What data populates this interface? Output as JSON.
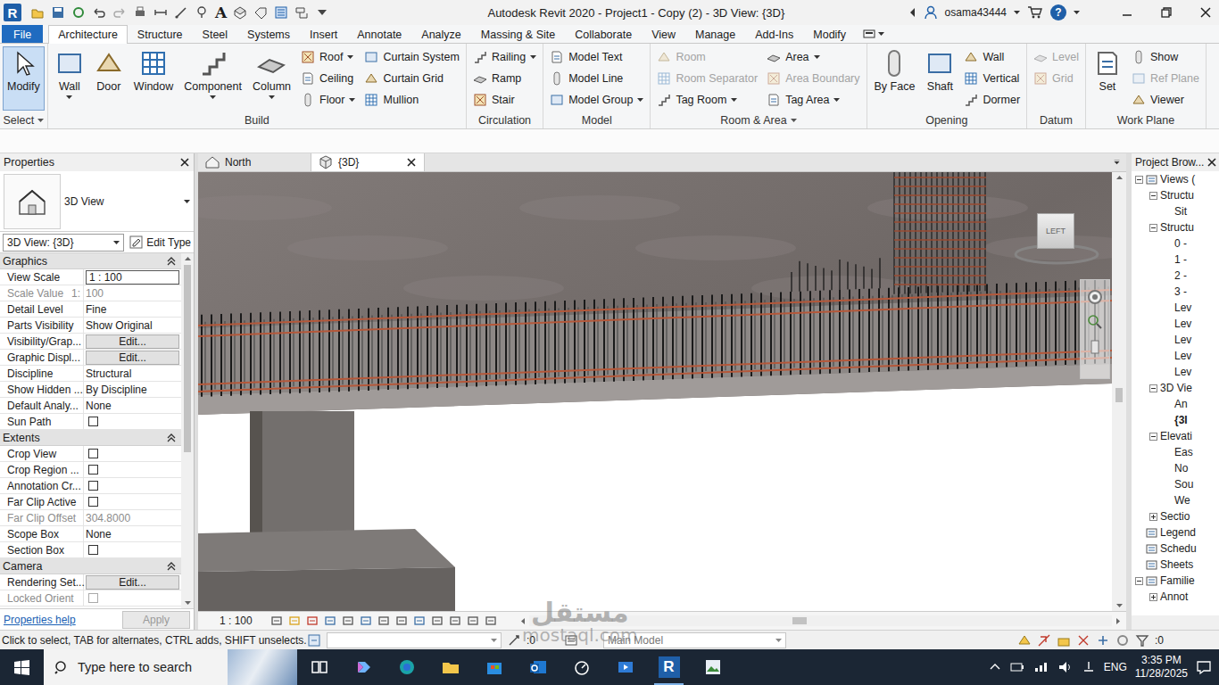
{
  "app_logo": "R",
  "window": {
    "title": "Autodesk Revit 2020 - Project1 - Copy (2) - 3D View: {3D}",
    "user": "osama43444",
    "help": "?"
  },
  "quick_access": {
    "text_tool": "A"
  },
  "ribbon_tabs": [
    {
      "label": "File",
      "selected": false,
      "kind": "file"
    },
    {
      "label": "Architecture",
      "selected": true,
      "kind": "tab"
    },
    {
      "label": "Structure",
      "selected": false,
      "kind": "tab"
    },
    {
      "label": "Steel",
      "selected": false,
      "kind": "tab"
    },
    {
      "label": "Systems",
      "selected": false,
      "kind": "tab"
    },
    {
      "label": "Insert",
      "selected": false,
      "kind": "tab"
    },
    {
      "label": "Annotate",
      "selected": false,
      "kind": "tab"
    },
    {
      "label": "Analyze",
      "selected": false,
      "kind": "tab"
    },
    {
      "label": "Massing & Site",
      "selected": false,
      "kind": "tab"
    },
    {
      "label": "Collaborate",
      "selected": false,
      "kind": "tab"
    },
    {
      "label": "View",
      "selected": false,
      "kind": "tab"
    },
    {
      "label": "Manage",
      "selected": false,
      "kind": "tab"
    },
    {
      "label": "Add-Ins",
      "selected": false,
      "kind": "tab"
    },
    {
      "label": "Modify",
      "selected": false,
      "kind": "tab"
    }
  ],
  "ribbon_groups": [
    {
      "title": "Select",
      "title_dropdown": true,
      "tools": [
        {
          "label": "Modify",
          "kind": "large",
          "selected": true,
          "disabled": false,
          "dropdown": false
        }
      ]
    },
    {
      "title": "Build",
      "title_dropdown": false,
      "tools": [
        {
          "label": "Wall",
          "kind": "large",
          "selected": false,
          "disabled": false,
          "dropdown": true
        },
        {
          "label": "Door",
          "kind": "large",
          "selected": false,
          "disabled": false,
          "dropdown": false
        },
        {
          "label": "Window",
          "kind": "large",
          "selected": false,
          "disabled": false,
          "dropdown": false
        },
        {
          "label": "Component",
          "kind": "large",
          "selected": false,
          "disabled": false,
          "dropdown": true
        },
        {
          "label": "Column",
          "kind": "large",
          "selected": false,
          "disabled": false,
          "dropdown": true
        },
        {
          "label": "Roof",
          "kind": "small",
          "selected": false,
          "disabled": false,
          "dropdown": true
        },
        {
          "label": "Ceiling",
          "kind": "small",
          "selected": false,
          "disabled": false,
          "dropdown": false
        },
        {
          "label": "Floor",
          "kind": "small",
          "selected": false,
          "disabled": false,
          "dropdown": true
        },
        {
          "label": "Curtain System",
          "kind": "small",
          "selected": false,
          "disabled": false,
          "dropdown": false
        },
        {
          "label": "Curtain Grid",
          "kind": "small",
          "selected": false,
          "disabled": false,
          "dropdown": false
        },
        {
          "label": "Mullion",
          "kind": "small",
          "selected": false,
          "disabled": false,
          "dropdown": false
        }
      ]
    },
    {
      "title": "Circulation",
      "title_dropdown": false,
      "tools": [
        {
          "label": "Railing",
          "kind": "small",
          "selected": false,
          "disabled": false,
          "dropdown": true
        },
        {
          "label": "Ramp",
          "kind": "small",
          "selected": false,
          "disabled": false,
          "dropdown": false
        },
        {
          "label": "Stair",
          "kind": "small",
          "selected": false,
          "disabled": false,
          "dropdown": false
        }
      ]
    },
    {
      "title": "Model",
      "title_dropdown": false,
      "tools": [
        {
          "label": "Model Text",
          "kind": "small",
          "selected": false,
          "disabled": false,
          "dropdown": false
        },
        {
          "label": "Model Line",
          "kind": "small",
          "selected": false,
          "disabled": false,
          "dropdown": false
        },
        {
          "label": "Model Group",
          "kind": "small",
          "selected": false,
          "disabled": false,
          "dropdown": true
        }
      ]
    },
    {
      "title": "Room & Area",
      "title_dropdown": true,
      "tools": [
        {
          "label": "Room",
          "kind": "small",
          "selected": false,
          "disabled": true,
          "dropdown": false
        },
        {
          "label": "Room Separator",
          "kind": "small",
          "selected": false,
          "disabled": true,
          "dropdown": false
        },
        {
          "label": "Tag Room",
          "kind": "small",
          "selected": false,
          "disabled": false,
          "dropdown": true
        },
        {
          "label": "Area",
          "kind": "small",
          "selected": false,
          "disabled": false,
          "dropdown": true
        },
        {
          "label": "Area Boundary",
          "kind": "small",
          "selected": false,
          "disabled": true,
          "dropdown": false
        },
        {
          "label": "Tag Area",
          "kind": "small",
          "selected": false,
          "disabled": false,
          "dropdown": true
        }
      ]
    },
    {
      "title": "Opening",
      "title_dropdown": false,
      "tools": [
        {
          "label": "By Face",
          "kind": "large",
          "selected": false,
          "disabled": false,
          "dropdown": false
        },
        {
          "label": "Shaft",
          "kind": "large",
          "selected": false,
          "disabled": false,
          "dropdown": false
        },
        {
          "label": "Wall",
          "kind": "small",
          "selected": false,
          "disabled": false,
          "dropdown": false
        },
        {
          "label": "Vertical",
          "kind": "small",
          "selected": false,
          "disabled": false,
          "dropdown": false
        },
        {
          "label": "Dormer",
          "kind": "small",
          "selected": false,
          "disabled": false,
          "dropdown": false
        }
      ]
    },
    {
      "title": "Datum",
      "title_dropdown": false,
      "tools": [
        {
          "label": "Level",
          "kind": "small",
          "selected": false,
          "disabled": true,
          "dropdown": false
        },
        {
          "label": "Grid",
          "kind": "small",
          "selected": false,
          "disabled": true,
          "dropdown": false
        }
      ]
    },
    {
      "title": "Work Plane",
      "title_dropdown": false,
      "tools": [
        {
          "label": "Set",
          "kind": "large",
          "selected": false,
          "disabled": false,
          "dropdown": false
        },
        {
          "label": "Show",
          "kind": "small",
          "selected": false,
          "disabled": false,
          "dropdown": false
        },
        {
          "label": "Ref Plane",
          "kind": "small",
          "selected": false,
          "disabled": true,
          "dropdown": false
        },
        {
          "label": "Viewer",
          "kind": "small",
          "selected": false,
          "disabled": false,
          "dropdown": false
        }
      ]
    }
  ],
  "properties": {
    "title": "Properties",
    "type_name": "3D View",
    "instance": "3D View: {3D}",
    "edit_type": "Edit Type",
    "sections": [
      {
        "title": "Graphics",
        "expanded": true,
        "rows": [
          {
            "label": "View Scale",
            "kind": "field",
            "value": "1 : 100",
            "disabled": false
          },
          {
            "label": "Scale Value",
            "suffix": "1:",
            "kind": "text",
            "value": "100",
            "disabled": true
          },
          {
            "label": "Detail Level",
            "kind": "text",
            "value": "Fine",
            "disabled": false
          },
          {
            "label": "Parts Visibility",
            "kind": "text",
            "value": "Show Original",
            "disabled": false
          },
          {
            "label": "Visibility/Grap...",
            "kind": "button",
            "value": "Edit...",
            "disabled": false
          },
          {
            "label": "Graphic Displ...",
            "kind": "button",
            "value": "Edit...",
            "disabled": false
          },
          {
            "label": "Discipline",
            "kind": "text",
            "value": "Structural",
            "disabled": false
          },
          {
            "label": "Show Hidden ...",
            "kind": "text",
            "value": "By Discipline",
            "disabled": false
          },
          {
            "label": "Default Analy...",
            "kind": "text",
            "value": "None",
            "disabled": false
          },
          {
            "label": "Sun Path",
            "kind": "checkbox",
            "checked": false,
            "disabled": false
          }
        ]
      },
      {
        "title": "Extents",
        "expanded": true,
        "rows": [
          {
            "label": "Crop View",
            "kind": "checkbox",
            "checked": false,
            "disabled": false
          },
          {
            "label": "Crop Region ...",
            "kind": "checkbox",
            "checked": false,
            "disabled": false
          },
          {
            "label": "Annotation Cr...",
            "kind": "checkbox",
            "checked": false,
            "disabled": false
          },
          {
            "label": "Far Clip Active",
            "kind": "checkbox",
            "checked": false,
            "disabled": false
          },
          {
            "label": "Far Clip Offset",
            "kind": "text",
            "value": "304.8000",
            "disabled": true
          },
          {
            "label": "Scope Box",
            "kind": "text",
            "value": "None",
            "disabled": false
          },
          {
            "label": "Section Box",
            "kind": "checkbox",
            "checked": false,
            "disabled": false
          }
        ]
      },
      {
        "title": "Camera",
        "expanded": true,
        "rows": [
          {
            "label": "Rendering Set...",
            "kind": "button",
            "value": "Edit...",
            "disabled": false
          },
          {
            "label": "Locked Orient",
            "kind": "checkbox",
            "checked": false,
            "disabled": true
          }
        ]
      }
    ],
    "help": "Properties help",
    "apply": "Apply",
    "apply_disabled": true
  },
  "view_tabs": [
    {
      "label": "North",
      "selected": false
    },
    {
      "label": "{3D}",
      "selected": true
    }
  ],
  "viewport": {
    "viewcube": "LEFT",
    "scale": "1 : 100"
  },
  "project_browser": {
    "title": "Project Brow...",
    "items": [
      {
        "label": "Views (",
        "level": 0,
        "kind": "branch",
        "expanded": true,
        "selected": false
      },
      {
        "label": "Structu",
        "level": 1,
        "kind": "branch",
        "expanded": true,
        "selected": false
      },
      {
        "label": "Sit",
        "level": 2,
        "kind": "leaf",
        "expanded": false,
        "selected": false
      },
      {
        "label": "Structu",
        "level": 1,
        "kind": "branch",
        "expanded": true,
        "selected": false
      },
      {
        "label": "0 -",
        "level": 2,
        "kind": "leaf",
        "expanded": false,
        "selected": false
      },
      {
        "label": "1 -",
        "level": 2,
        "kind": "leaf",
        "expanded": false,
        "selected": false
      },
      {
        "label": "2 -",
        "level": 2,
        "kind": "leaf",
        "expanded": false,
        "selected": false
      },
      {
        "label": "3 -",
        "level": 2,
        "kind": "leaf",
        "expanded": false,
        "selected": false
      },
      {
        "label": "Lev",
        "level": 2,
        "kind": "leaf",
        "expanded": false,
        "selected": false
      },
      {
        "label": "Lev",
        "level": 2,
        "kind": "leaf",
        "expanded": false,
        "selected": false
      },
      {
        "label": "Lev",
        "level": 2,
        "kind": "leaf",
        "expanded": false,
        "selected": false
      },
      {
        "label": "Lev",
        "level": 2,
        "kind": "leaf",
        "expanded": false,
        "selected": false
      },
      {
        "label": "Lev",
        "level": 2,
        "kind": "leaf",
        "expanded": false,
        "selected": false
      },
      {
        "label": "3D Vie",
        "level": 1,
        "kind": "branch",
        "expanded": true,
        "selected": false
      },
      {
        "label": "An",
        "level": 2,
        "kind": "leaf",
        "expanded": false,
        "selected": false
      },
      {
        "label": "{3I",
        "level": 2,
        "kind": "leaf",
        "expanded": false,
        "selected": true
      },
      {
        "label": "Elevati",
        "level": 1,
        "kind": "branch",
        "expanded": true,
        "selected": false
      },
      {
        "label": "Eas",
        "level": 2,
        "kind": "leaf",
        "expanded": false,
        "selected": false
      },
      {
        "label": "No",
        "level": 2,
        "kind": "leaf",
        "expanded": false,
        "selected": false
      },
      {
        "label": "Sou",
        "level": 2,
        "kind": "leaf",
        "expanded": false,
        "selected": false
      },
      {
        "label": "We",
        "level": 2,
        "kind": "leaf",
        "expanded": false,
        "selected": false
      },
      {
        "label": "Sectio",
        "level": 1,
        "kind": "branch",
        "expanded": false,
        "selected": false
      },
      {
        "label": "Legend",
        "level": 0,
        "kind": "leaf",
        "expanded": false,
        "selected": false
      },
      {
        "label": "Schedu",
        "level": 0,
        "kind": "leaf",
        "expanded": false,
        "selected": false
      },
      {
        "label": "Sheets",
        "level": 0,
        "kind": "leaf",
        "expanded": false,
        "selected": false
      },
      {
        "label": "Familie",
        "level": 0,
        "kind": "branch",
        "expanded": true,
        "selected": false
      },
      {
        "label": "Annot",
        "level": 1,
        "kind": "branch",
        "expanded": false,
        "selected": false
      }
    ]
  },
  "status_bar": {
    "message": "Click to select, TAB for alternates, CTRL adds, SHIFT unselects.",
    "selection_count": ":0",
    "workset": "Main Model",
    "filter_count": ":0"
  },
  "taskbar": {
    "search_placeholder": "Type here to search",
    "app_logo": "R",
    "language": "ENG",
    "time": "3:35 PM",
    "date": "11/28/2025"
  },
  "watermark": {
    "arabic": "مستقل",
    "latin": "mostaql.com"
  }
}
